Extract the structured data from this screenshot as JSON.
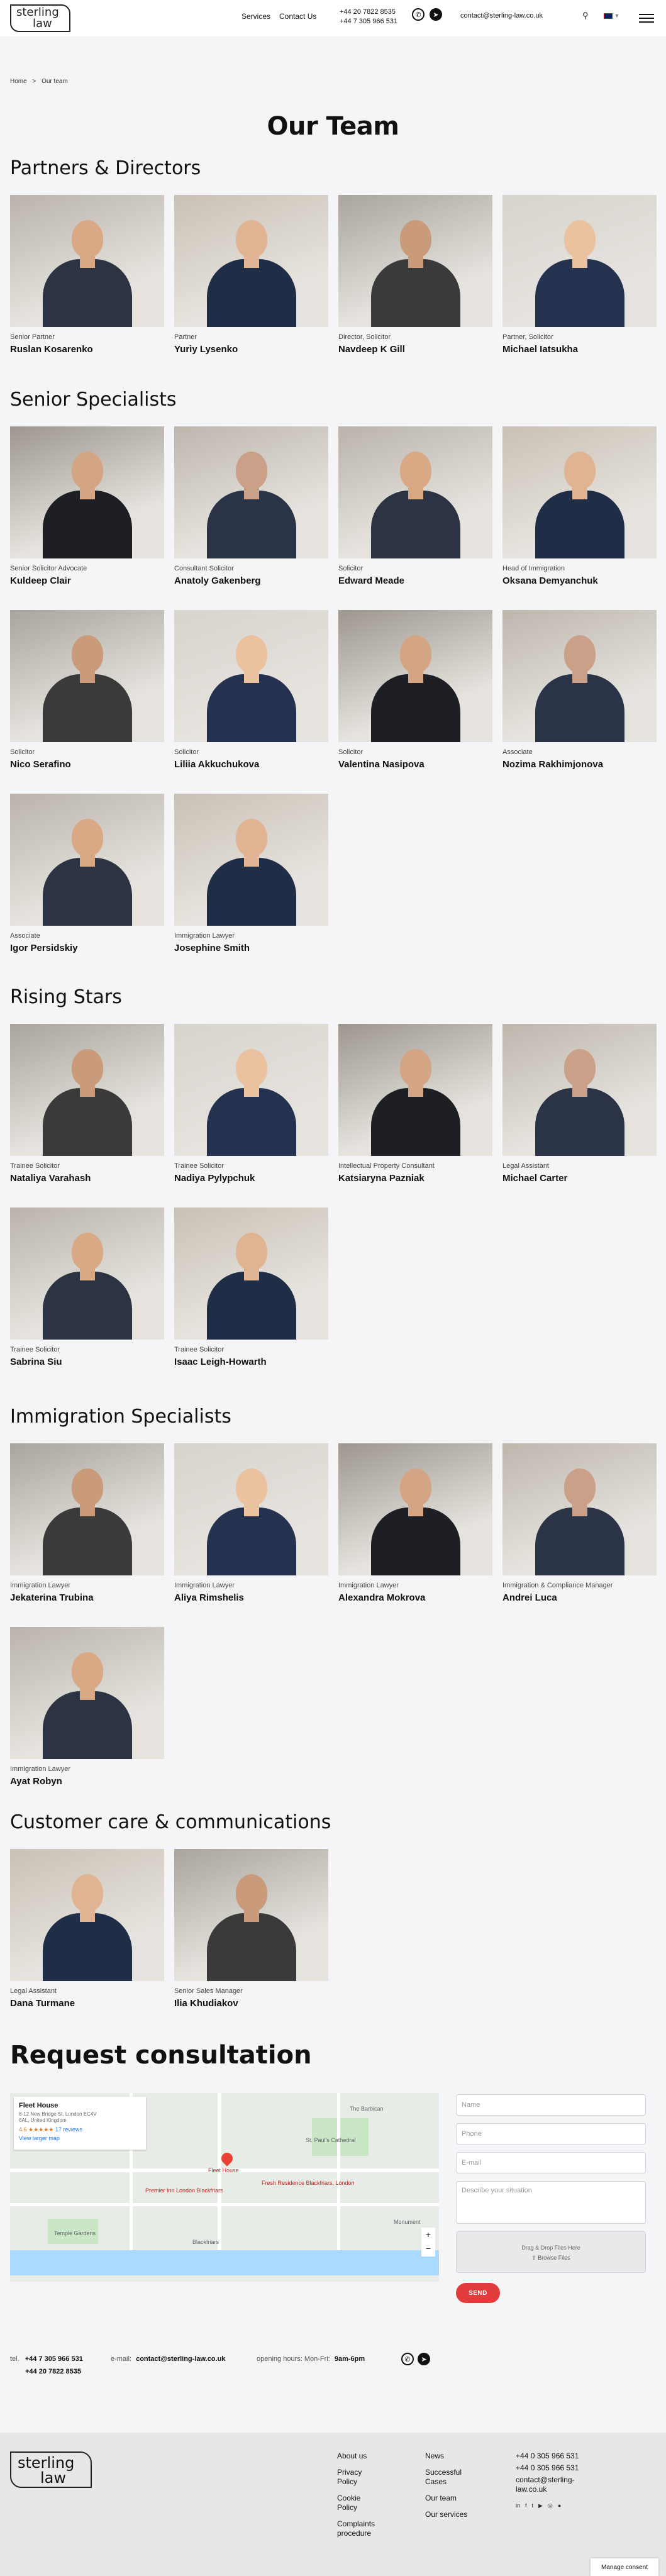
{
  "header": {
    "logo": [
      "sterling",
      "law"
    ],
    "nav": [
      "Services",
      "Contact Us"
    ],
    "phones": [
      "+44 20 7822 8535",
      "+44 7 305 966 531"
    ],
    "email": "contact@sterling-law.co.uk",
    "lang": "▼"
  },
  "breadcrumb": [
    "Home",
    ">",
    "Our team"
  ],
  "page_title": "Our Team",
  "sections": [
    {
      "title": "Partners & Directors",
      "members": [
        {
          "role": "Senior Partner",
          "name": "Ruslan Kosarenko"
        },
        {
          "role": "Partner",
          "name": "Yuriy Lysenko"
        },
        {
          "role": "Director, Solicitor",
          "name": "Navdeep K Gill"
        },
        {
          "role": "Partner, Solicitor",
          "name": "Michael Iatsukha"
        }
      ]
    },
    {
      "title": "Senior Specialists",
      "members": [
        {
          "role": "Senior Solicitor Advocate",
          "name": "Kuldeep Clair"
        },
        {
          "role": "Consultant Solicitor",
          "name": "Anatoly Gakenberg"
        },
        {
          "role": "Solicitor",
          "name": "Edward Meade"
        },
        {
          "role": "Head of Immigration",
          "name": "Oksana Demyanchuk"
        },
        {
          "role": "Solicitor",
          "name": "Nico Serafino"
        },
        {
          "role": "Solicitor",
          "name": "Liliia Akkuchukova"
        },
        {
          "role": "Solicitor",
          "name": "Valentina Nasipova"
        },
        {
          "role": "Associate",
          "name": "Nozima Rakhimjonova"
        },
        {
          "role": "Associate",
          "name": "Igor Persidskiy"
        },
        {
          "role": "Immigration Lawyer",
          "name": "Josephine Smith"
        }
      ]
    },
    {
      "title": "Rising Stars",
      "members": [
        {
          "role": "Trainee Solicitor",
          "name": "Nataliya Varahash"
        },
        {
          "role": "Trainee Solicitor",
          "name": "Nadiya Pylypchuk"
        },
        {
          "role": "Intellectual Property Consultant",
          "name": "Katsiaryna Pazniak"
        },
        {
          "role": "Legal Assistant",
          "name": "Michael Carter"
        },
        {
          "role": "Trainee Solicitor",
          "name": "Sabrina Siu"
        },
        {
          "role": "Trainee Solicitor",
          "name": "Isaac Leigh-Howarth"
        }
      ]
    },
    {
      "title": "Immigration Specialists",
      "members": [
        {
          "role": "Immigration Lawyer",
          "name": "Jekaterina Trubina"
        },
        {
          "role": "Immigration Lawyer",
          "name": "Aliya Rimshelis"
        },
        {
          "role": "Immigration Lawyer",
          "name": "Alexandra Mokrova"
        },
        {
          "role": "Immigration & Compliance Manager",
          "name": "Andrei Luca"
        },
        {
          "role": "Immigration Lawyer",
          "name": "Ayat Robyn"
        }
      ]
    },
    {
      "title": "Customer care & communications",
      "members": [
        {
          "role": "Legal Assistant",
          "name": "Dana Turmane"
        },
        {
          "role": "Senior Sales Manager",
          "name": "Ilia Khudiakov"
        }
      ]
    }
  ],
  "consultation": {
    "title": "Request consultation",
    "map": {
      "place": "Fleet House",
      "address": "8-12 New Bridge St, London EC4V 6AL, United Kingdom",
      "rating": "4.6 ★★★★★",
      "reviews": "17 reviews",
      "link": "View larger map",
      "labels": [
        "Fleet House",
        "St. Paul's Cathedral",
        "Premier Inn London Blackfriars",
        "Fresh Residence Blackfriars, London",
        "The Barbican",
        "Temple Gardens",
        "Blackfriars",
        "Monument"
      ]
    },
    "fields": [
      "Name",
      "Phone",
      "E-mail",
      "Describe your situation"
    ],
    "dropzone": "Drag & Drop Files Here",
    "browse": "Browse Files",
    "send": "SEND"
  },
  "contact_bar": {
    "tel_label": "tel.",
    "tel1": "+44 7 305 966 531",
    "tel2": "+44 20 7822 8535",
    "email_label": "e-mail:",
    "email": "contact@sterling-law.co.uk",
    "hours_label": "opening hours: Mon-Fri:",
    "hours": "9am-6pm"
  },
  "footer": {
    "col1": [
      "About us",
      "Privacy Policy",
      "Cookie Policy",
      "Complaints procedure"
    ],
    "col2": [
      "News",
      "Successful Cases",
      "Our team",
      "Our services"
    ],
    "phones": [
      "+44 0 305 966 531",
      "+44 0 305 966 531"
    ],
    "email": "contact@sterling-law.co.uk",
    "consent": "Manage consent"
  }
}
